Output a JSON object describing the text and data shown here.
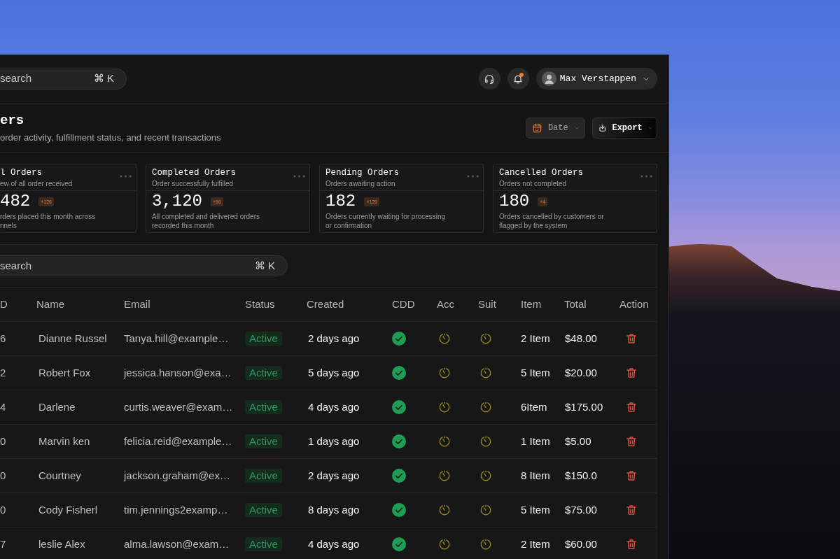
{
  "top_bar": {
    "search": {
      "placeholder": "search",
      "shortcut": "⌘ K"
    },
    "notifications": {
      "unread": true
    },
    "user": {
      "name": "Max Verstappen"
    }
  },
  "header": {
    "title": "ers",
    "subtitle": "order activity, fulfillment status, and recent transactions",
    "buttons": [
      {
        "kind": "date",
        "label": "Date"
      },
      {
        "kind": "export",
        "label": "Export"
      }
    ]
  },
  "stat_cards": [
    {
      "title": "l Orders",
      "subtitle": "ew of all order received",
      "value": "482",
      "change": "+126",
      "description": [
        "rders placed this month across",
        "nnels"
      ]
    },
    {
      "title": "Completed Orders",
      "subtitle": "Order successfully fulfilled",
      "value": "3,120",
      "change": "+56",
      "description": [
        "All completed and delivered orders",
        "recorded this month"
      ]
    },
    {
      "title": "Pending Orders",
      "subtitle": "Orders awaiting action",
      "value": "182",
      "change": "+126",
      "description": [
        "Orders currently waiting for processing",
        "or confirmation"
      ]
    },
    {
      "title": "Cancelled Orders",
      "subtitle": "Orders not completed",
      "value": "180",
      "change": "+4",
      "description": [
        "Orders cancelled by customers or",
        "flagged by the system"
      ]
    }
  ],
  "orders_table": {
    "search": {
      "placeholder": "search",
      "shortcut": "⌘ K"
    },
    "columns": [
      "D",
      "Name",
      "Email",
      "Status",
      "Created",
      "CDD",
      "Acc",
      "Suit",
      "Item",
      "Total",
      "Action"
    ],
    "rows": [
      {
        "column_1": "6",
        "name": "Dianne Russel",
        "email": "Tanya.hill@example…",
        "status": "Active",
        "created": "2 days ago",
        "cdd_complete": true,
        "acc_complete": false,
        "suit_complete": false,
        "item": "2 Item",
        "total": "$48.00"
      },
      {
        "column_1": "2",
        "name": "Robert Fox",
        "email": "jessica.hanson@exa…",
        "status": "Active",
        "created": "5 days ago",
        "cdd_complete": true,
        "acc_complete": false,
        "suit_complete": false,
        "item": "5 Item",
        "total": "$20.00"
      },
      {
        "column_1": "4",
        "name": "Darlene",
        "email": "curtis.weaver@exam…",
        "status": "Active",
        "created": "4 days ago",
        "cdd_complete": true,
        "acc_complete": false,
        "suit_complete": false,
        "item": "6Item",
        "total": "$175.00"
      },
      {
        "column_1": "0",
        "name": "Marvin ken",
        "email": "felicia.reid@example…",
        "status": "Active",
        "created": "1 days ago",
        "cdd_complete": true,
        "acc_complete": false,
        "suit_complete": false,
        "item": "1 Item",
        "total": "$5.00"
      },
      {
        "column_1": "0",
        "name": "Courtney",
        "email": "jackson.graham@ex…",
        "status": "Active",
        "created": "2 days ago",
        "cdd_complete": true,
        "acc_complete": false,
        "suit_complete": false,
        "item": "8 Item",
        "total": "$150.0"
      },
      {
        "column_1": "0",
        "name": "Cody Fisherl",
        "email": "tim.jennings2examp…",
        "status": "Active",
        "created": "8 days ago",
        "cdd_complete": true,
        "acc_complete": false,
        "suit_complete": false,
        "item": "5 Item",
        "total": "$75.00"
      },
      {
        "column_1": "7",
        "name": "leslie Alex",
        "email": "alma.lawson@exam…",
        "status": "Active",
        "created": "4 days ago",
        "cdd_complete": true,
        "acc_complete": false,
        "suit_complete": false,
        "item": "2 Item",
        "total": "$60.00"
      }
    ]
  }
}
